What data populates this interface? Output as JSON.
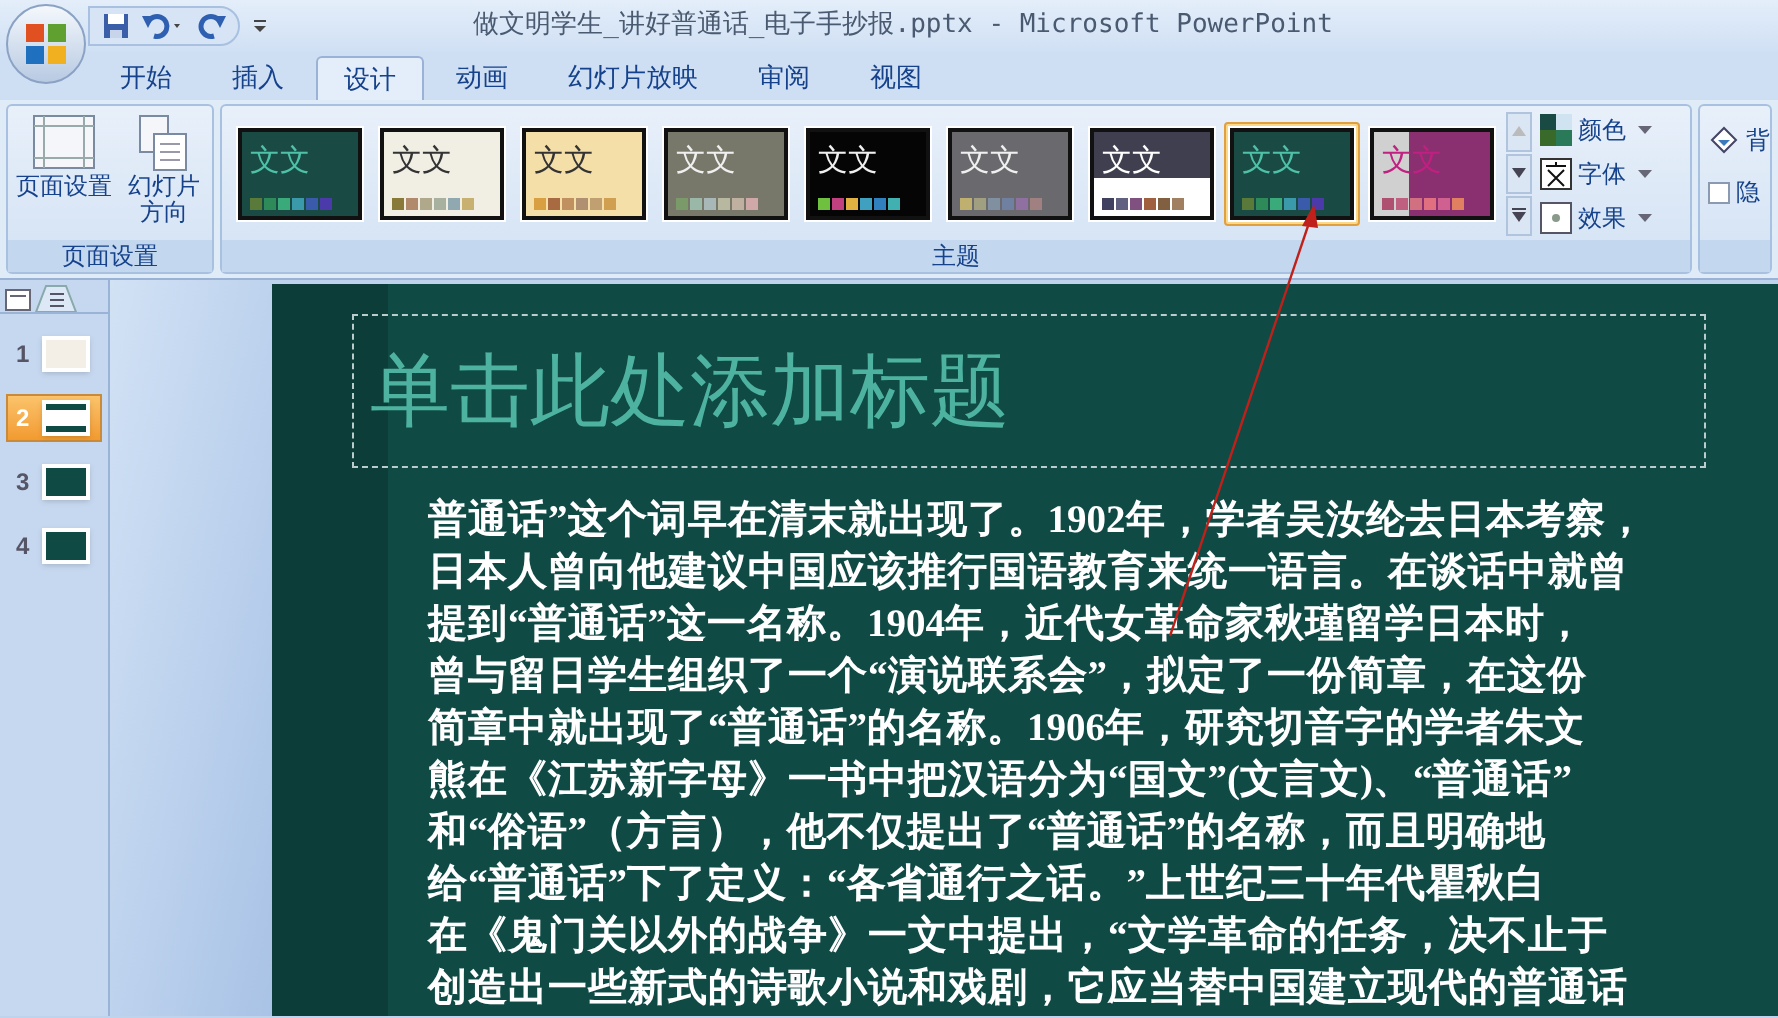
{
  "window": {
    "title": "做文明学生_讲好普通话_电子手抄报.pptx - Microsoft PowerPoint"
  },
  "tabs": [
    {
      "label": "开始",
      "selected": false
    },
    {
      "label": "插入",
      "selected": false
    },
    {
      "label": "设计",
      "selected": true
    },
    {
      "label": "动画",
      "selected": false
    },
    {
      "label": "幻灯片放映",
      "selected": false
    },
    {
      "label": "审阅",
      "selected": false
    },
    {
      "label": "视图",
      "selected": false
    }
  ],
  "ribbon": {
    "page_setup": {
      "buttons": [
        {
          "kind": "page",
          "label": "页面设置"
        },
        {
          "kind": "orient",
          "label": "幻灯片方向"
        }
      ],
      "label": "页面设置"
    },
    "themes": {
      "label": "主题",
      "items": [
        {
          "label": "文文",
          "kind": "teal",
          "color": "#1a4a44",
          "selected": false,
          "swatches": [
            {
              "color": "#5a7a3a"
            },
            {
              "color": "#2f8a5a"
            },
            {
              "color": "#3aaa7a"
            },
            {
              "color": "#3a9aaa"
            },
            {
              "color": "#3a5aaa"
            },
            {
              "color": "#4a3aaa"
            }
          ]
        },
        {
          "label": "文文",
          "kind": "light",
          "color": "#f1eee3",
          "selected": false,
          "swatches": [
            {
              "color": "#8a7a3a"
            },
            {
              "color": "#b08a6a"
            },
            {
              "color": "#b0a88a"
            },
            {
              "color": "#a8b0a0"
            },
            {
              "color": "#90a8b0"
            },
            {
              "color": "#c8b070"
            }
          ]
        },
        {
          "label": "文文",
          "kind": "light",
          "color": "#f5dfa8",
          "selected": false,
          "swatches": [
            {
              "color": "#d8a040"
            },
            {
              "color": "#a86a40"
            },
            {
              "color": "#c09060"
            },
            {
              "color": "#b09070"
            },
            {
              "color": "#c0a070"
            },
            {
              "color": "#d0a050"
            }
          ]
        },
        {
          "label": "文文",
          "kind": "dark",
          "color": "#77776a",
          "selected": false,
          "swatches": [
            {
              "color": "#7a9a6a"
            },
            {
              "color": "#9ab8a8"
            },
            {
              "color": "#a8b8b8"
            },
            {
              "color": "#b8b8a0"
            },
            {
              "color": "#c0b0a0"
            },
            {
              "color": "#d0a8a8"
            }
          ]
        },
        {
          "label": "文文",
          "kind": "dark",
          "color": "#050505",
          "selected": false,
          "swatches": [
            {
              "color": "#70c040"
            },
            {
              "color": "#c04080"
            },
            {
              "color": "#e0b040"
            },
            {
              "color": "#40a0c0"
            },
            {
              "color": "#3080c0"
            },
            {
              "color": "#40b0b0"
            }
          ]
        },
        {
          "label": "文文",
          "kind": "dark",
          "color": "#6a6a6e",
          "selected": false,
          "swatches": [
            {
              "color": "#c0b070"
            },
            {
              "color": "#a0a080"
            },
            {
              "color": "#8090a0"
            },
            {
              "color": "#7080a0"
            },
            {
              "color": "#9070a0"
            },
            {
              "color": "#a08080"
            }
          ]
        },
        {
          "label": "文文",
          "kind": "split",
          "color": "#3f3f4f",
          "selected": false,
          "swatches": [
            {
              "color": "#404060"
            },
            {
              "color": "#606080"
            },
            {
              "color": "#805080"
            },
            {
              "color": "#a06040"
            },
            {
              "color": "#806040"
            },
            {
              "color": "#a08060"
            }
          ]
        },
        {
          "label": "文文",
          "kind": "teal",
          "color": "#1a4a44",
          "selected": true,
          "swatches": [
            {
              "color": "#5a7a3a"
            },
            {
              "color": "#2f8a5a"
            },
            {
              "color": "#3aaa7a"
            },
            {
              "color": "#3a9aaa"
            },
            {
              "color": "#3a5aaa"
            },
            {
              "color": "#4a3aaa"
            }
          ]
        },
        {
          "label": "文文",
          "kind": "magenta",
          "color": "#8a3070",
          "selected": false,
          "swatches": [
            {
              "color": "#b05070"
            },
            {
              "color": "#c06080"
            },
            {
              "color": "#d07080"
            },
            {
              "color": "#e07080"
            },
            {
              "color": "#d06090"
            },
            {
              "color": "#e08060"
            }
          ]
        }
      ],
      "options": [
        {
          "kind": "colors",
          "label": "颜色"
        },
        {
          "kind": "fonts",
          "label": "字体"
        },
        {
          "kind": "effects",
          "label": "效果"
        }
      ]
    },
    "background": {
      "items": [
        {
          "kind": "styles",
          "label": "背"
        },
        {
          "kind": "hide",
          "label": "隐",
          "checked": false
        }
      ]
    }
  },
  "slides_pane": {
    "slides": [
      {
        "number": "1",
        "kind": "light",
        "selected": false
      },
      {
        "number": "2",
        "kind": "title",
        "selected": true
      },
      {
        "number": "3",
        "kind": "dark",
        "selected": false
      },
      {
        "number": "4",
        "kind": "dark",
        "selected": false
      }
    ]
  },
  "slide": {
    "title_placeholder": "单击此处添加标题",
    "body_lines": [
      "普通话”这个词早在清末就出现了。1902年，学者吴汝纶去日本考察，",
      "日本人曾向他建议中国应该推行国语教育来统一语言。在谈话中就曾",
      "提到“普通话”这一名称。1904年，近代女革命家秋瑾留学日本时，",
      "曾与留日学生组织了一个“演说联系会”，拟定了一份简章，在这份",
      "简章中就出现了“普通话”的名称。1906年，研究切音字的学者朱文",
      "熊在《江苏新字母》一书中把汉语分为“国文”(文言文)、“普通话”",
      "和“俗语”（方言），他不仅提出了“普通话”的名称，而且明确地",
      "给“普通话”下了定义：“各省通行之话。”上世纪三十年代瞿秋白",
      "在《鬼门关以外的战争》一文中提出，“文学革命的任务，决不止于",
      "创造出一些新式的诗歌小说和戏剧，它应当替中国建立现代的普通话"
    ]
  }
}
